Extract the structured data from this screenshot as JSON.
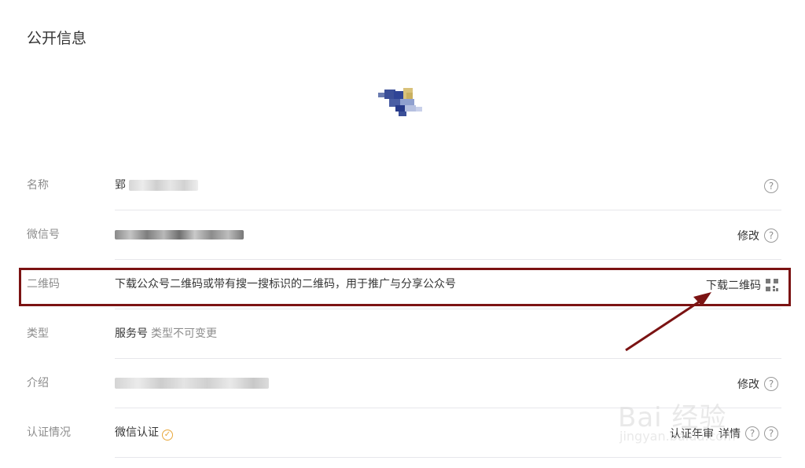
{
  "section": {
    "title": "公开信息"
  },
  "rows": [
    {
      "label": "名称",
      "value": "郢",
      "actions": []
    },
    {
      "label": "微信号",
      "value": "",
      "actions": [
        "修改"
      ]
    },
    {
      "label": "二维码",
      "value": "下载公众号二维码或带有搜一搜标识的二维码，用于推广与分享公众号",
      "actions": [
        "下载二维码"
      ]
    },
    {
      "label": "类型",
      "value": "服务号",
      "note": "类型不可变更",
      "actions": []
    },
    {
      "label": "介绍",
      "value": "",
      "actions": [
        "修改"
      ]
    },
    {
      "label": "认证情况",
      "value": "微信认证",
      "actions": [
        "认证年审",
        "详情"
      ]
    }
  ],
  "icons": {
    "help": "question-circle-icon",
    "qr": "qr-code-icon",
    "verified": "verified-check-icon"
  },
  "colors": {
    "highlight": "#7b1313",
    "verified": "#e8a73a",
    "label": "#8d8d8d",
    "divider": "#e7e7eb"
  },
  "watermark": {
    "main": "Bai 经验",
    "sub": "jingyan.baidu.com"
  }
}
